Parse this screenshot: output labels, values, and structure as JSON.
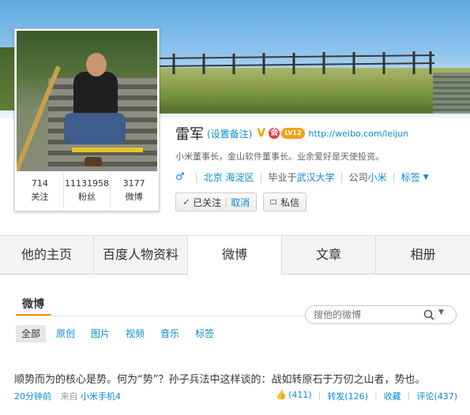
{
  "profile": {
    "name": "雷军",
    "remark_label": "(设置备注)",
    "verified_badge": "V",
    "level_badge": "LV12",
    "weibo_url": "http://weibo.com/leijun",
    "bio": "小米董事长，金山软件董事长。业余爱好是天使投资。",
    "gender_symbol": "♂",
    "location": "北京 海淀区",
    "education_prefix": "毕业于",
    "school": "武汉大学",
    "company_prefix": "公司",
    "company": "小米",
    "tags_label": "标签"
  },
  "stats": [
    {
      "value": "714",
      "label": "关注"
    },
    {
      "value": "11131958",
      "label": "粉丝"
    },
    {
      "value": "3177",
      "label": "微博"
    }
  ],
  "buttons": {
    "followed_label": "已关注",
    "cancel_label": "取消",
    "message_label": "私信"
  },
  "tabs": [
    {
      "label": "他的主页",
      "active": false
    },
    {
      "label": "百度人物资料",
      "active": false
    },
    {
      "label": "微博",
      "active": true
    },
    {
      "label": "文章",
      "active": false
    },
    {
      "label": "相册",
      "active": false
    }
  ],
  "feed": {
    "title": "微博",
    "search_placeholder": "搜他的微博",
    "filters": [
      {
        "label": "全部",
        "active": true
      },
      {
        "label": "原创",
        "active": false
      },
      {
        "label": "图片",
        "active": false
      },
      {
        "label": "视频",
        "active": false
      },
      {
        "label": "音乐",
        "active": false
      },
      {
        "label": "标签",
        "active": false
      }
    ]
  },
  "post": {
    "text": "顺势而为的核心是势。何为“势”？孙子兵法中这样谈的：战如转原石于万仞之山者，势也。",
    "time": "20分钟前",
    "source_prefix": "来自",
    "source": "小米手机4",
    "likes": "(411)",
    "repost_label": "转发(126)",
    "favorite_label": "收藏",
    "comment_label": "评论(437)"
  },
  "colors": {
    "link": "#0a8cd2",
    "accent": "#ff8c00",
    "tab_bg": "#f0f0f0"
  }
}
